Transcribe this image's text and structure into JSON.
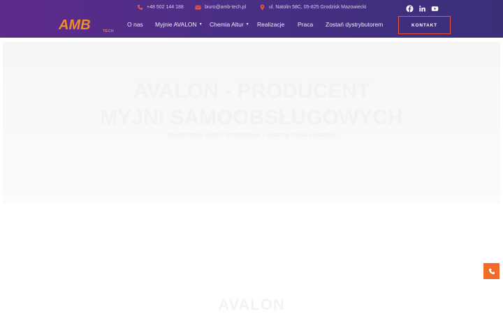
{
  "topbar": {
    "phone": "+48 502 144 188",
    "email": "biuro@amb-tech.pl",
    "address": "ul. Natolin 58C, 05-825 Grodzisk Mazowiecki",
    "icons": [
      "phone-icon",
      "mail-icon",
      "location-pin-icon"
    ],
    "social": [
      "facebook-icon",
      "linkedin-icon",
      "youtube-icon"
    ]
  },
  "logo": {
    "main": "AMB",
    "sub": "TECH"
  },
  "nav": {
    "items": [
      {
        "label": "O nas",
        "dropdown": false
      },
      {
        "label": "Myjnie AVALON",
        "dropdown": true
      },
      {
        "label": "Chemia Altur",
        "dropdown": true
      },
      {
        "label": "Realizacje",
        "dropdown": false
      },
      {
        "label": "Praca",
        "dropdown": false
      },
      {
        "label": "Zostań dystrybutorem",
        "dropdown": false
      }
    ],
    "cta": "KONTAKT"
  },
  "hero": {
    "title_line1": "AVALON - PRODUCENT",
    "title_line2": "MYJNI SAMOOBSŁUGOWYCH",
    "subtitle": "Nowoczesne myjnie bezdotykowe i systemy mycia pojazdów"
  },
  "section": {
    "heading": "AVALON"
  },
  "colors": {
    "header_start": "#5e2a8c",
    "header_end": "#3b2f7a",
    "accent_orange": "#f28a2e",
    "icon_red": "#e8543c",
    "call_button": "#f06a2a"
  }
}
